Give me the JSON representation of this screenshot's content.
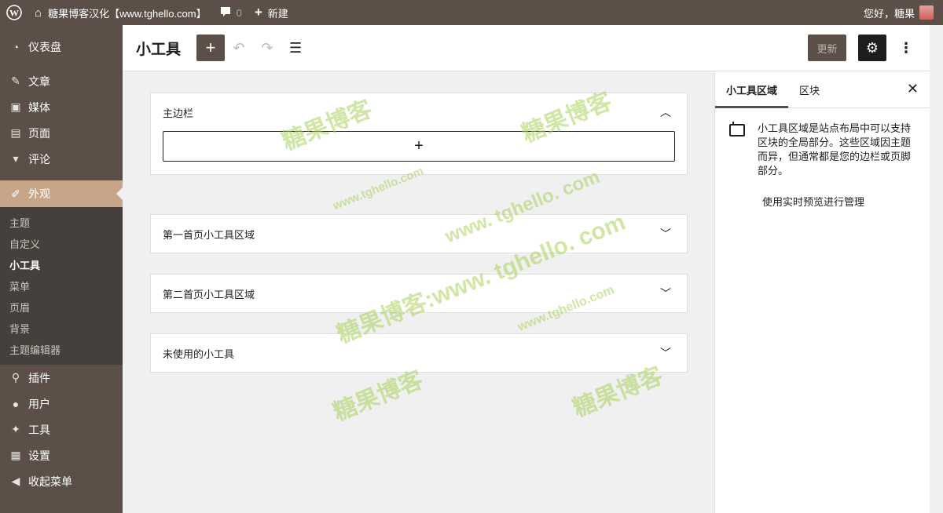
{
  "adminbar": {
    "site_name": "糖果博客汉化【www.tghello.com】",
    "comments_count": "0",
    "new_label": "新建",
    "greeting": "您好，糖果"
  },
  "menu": {
    "dashboard": "仪表盘",
    "posts": "文章",
    "media": "媒体",
    "pages": "页面",
    "comments": "评论",
    "appearance": "外观",
    "sub": [
      "主题",
      "自定义",
      "小工具",
      "菜单",
      "页眉",
      "背景",
      "主题编辑器"
    ],
    "plugins": "插件",
    "users": "用户",
    "tools": "工具",
    "settings": "设置",
    "collapse": "收起菜单"
  },
  "header": {
    "title": "小工具",
    "update_label": "更新"
  },
  "panels": [
    {
      "title": "主边栏"
    },
    {
      "title": "第一首页小工具区域"
    },
    {
      "title": "第二首页小工具区域"
    },
    {
      "title": "未使用的小工具"
    }
  ],
  "settings_sidebar": {
    "tab_area": "小工具区域",
    "tab_block": "区块",
    "description": "小工具区域是站点布局中可以支持区块的全局部分。这些区域因主题而异，但通常都是您的边栏或页脚部分。",
    "live_preview": "使用实时预览进行管理"
  },
  "watermarks": [
    "糖果博客",
    "糖果博客",
    "www.tghello.com",
    "www. tghello. com",
    "糖果博客:www. tghello. com",
    "www.tghello.com",
    "糖果博客",
    "糖果博客"
  ],
  "colors": {
    "admin_bg": "#5b4f47",
    "current_menu": "#c7a589",
    "submenu_bg": "#46403c"
  }
}
